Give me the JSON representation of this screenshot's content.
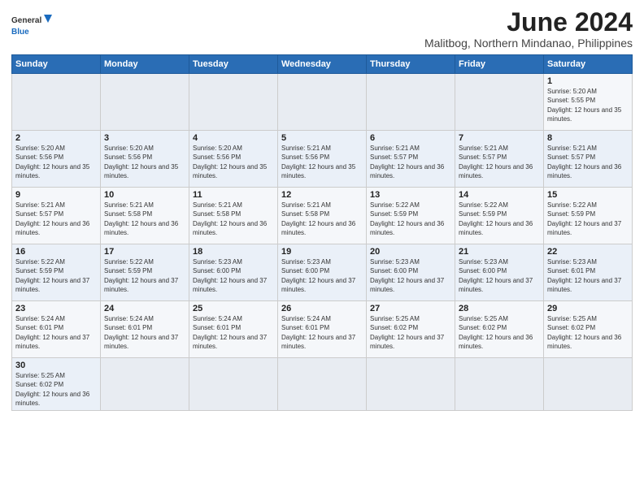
{
  "header": {
    "logo_general": "General",
    "logo_blue": "Blue",
    "title": "June 2024",
    "subtitle": "Malitbog, Northern Mindanao, Philippines"
  },
  "days_of_week": [
    "Sunday",
    "Monday",
    "Tuesday",
    "Wednesday",
    "Thursday",
    "Friday",
    "Saturday"
  ],
  "weeks": [
    [
      {
        "day": "",
        "info": ""
      },
      {
        "day": "",
        "info": ""
      },
      {
        "day": "",
        "info": ""
      },
      {
        "day": "",
        "info": ""
      },
      {
        "day": "",
        "info": ""
      },
      {
        "day": "",
        "info": ""
      },
      {
        "day": "1",
        "info": "Sunrise: 5:20 AM\nSunset: 5:55 PM\nDaylight: 12 hours and 35 minutes."
      }
    ],
    [
      {
        "day": "2",
        "info": "Sunrise: 5:20 AM\nSunset: 5:56 PM\nDaylight: 12 hours and 35 minutes."
      },
      {
        "day": "3",
        "info": "Sunrise: 5:20 AM\nSunset: 5:56 PM\nDaylight: 12 hours and 35 minutes."
      },
      {
        "day": "4",
        "info": "Sunrise: 5:20 AM\nSunset: 5:56 PM\nDaylight: 12 hours and 35 minutes."
      },
      {
        "day": "5",
        "info": "Sunrise: 5:21 AM\nSunset: 5:56 PM\nDaylight: 12 hours and 35 minutes."
      },
      {
        "day": "6",
        "info": "Sunrise: 5:21 AM\nSunset: 5:57 PM\nDaylight: 12 hours and 36 minutes."
      },
      {
        "day": "7",
        "info": "Sunrise: 5:21 AM\nSunset: 5:57 PM\nDaylight: 12 hours and 36 minutes."
      },
      {
        "day": "8",
        "info": "Sunrise: 5:21 AM\nSunset: 5:57 PM\nDaylight: 12 hours and 36 minutes."
      }
    ],
    [
      {
        "day": "9",
        "info": "Sunrise: 5:21 AM\nSunset: 5:57 PM\nDaylight: 12 hours and 36 minutes."
      },
      {
        "day": "10",
        "info": "Sunrise: 5:21 AM\nSunset: 5:58 PM\nDaylight: 12 hours and 36 minutes."
      },
      {
        "day": "11",
        "info": "Sunrise: 5:21 AM\nSunset: 5:58 PM\nDaylight: 12 hours and 36 minutes."
      },
      {
        "day": "12",
        "info": "Sunrise: 5:21 AM\nSunset: 5:58 PM\nDaylight: 12 hours and 36 minutes."
      },
      {
        "day": "13",
        "info": "Sunrise: 5:22 AM\nSunset: 5:59 PM\nDaylight: 12 hours and 36 minutes."
      },
      {
        "day": "14",
        "info": "Sunrise: 5:22 AM\nSunset: 5:59 PM\nDaylight: 12 hours and 36 minutes."
      },
      {
        "day": "15",
        "info": "Sunrise: 5:22 AM\nSunset: 5:59 PM\nDaylight: 12 hours and 37 minutes."
      }
    ],
    [
      {
        "day": "16",
        "info": "Sunrise: 5:22 AM\nSunset: 5:59 PM\nDaylight: 12 hours and 37 minutes."
      },
      {
        "day": "17",
        "info": "Sunrise: 5:22 AM\nSunset: 5:59 PM\nDaylight: 12 hours and 37 minutes."
      },
      {
        "day": "18",
        "info": "Sunrise: 5:23 AM\nSunset: 6:00 PM\nDaylight: 12 hours and 37 minutes."
      },
      {
        "day": "19",
        "info": "Sunrise: 5:23 AM\nSunset: 6:00 PM\nDaylight: 12 hours and 37 minutes."
      },
      {
        "day": "20",
        "info": "Sunrise: 5:23 AM\nSunset: 6:00 PM\nDaylight: 12 hours and 37 minutes."
      },
      {
        "day": "21",
        "info": "Sunrise: 5:23 AM\nSunset: 6:00 PM\nDaylight: 12 hours and 37 minutes."
      },
      {
        "day": "22",
        "info": "Sunrise: 5:23 AM\nSunset: 6:01 PM\nDaylight: 12 hours and 37 minutes."
      }
    ],
    [
      {
        "day": "23",
        "info": "Sunrise: 5:24 AM\nSunset: 6:01 PM\nDaylight: 12 hours and 37 minutes."
      },
      {
        "day": "24",
        "info": "Sunrise: 5:24 AM\nSunset: 6:01 PM\nDaylight: 12 hours and 37 minutes."
      },
      {
        "day": "25",
        "info": "Sunrise: 5:24 AM\nSunset: 6:01 PM\nDaylight: 12 hours and 37 minutes."
      },
      {
        "day": "26",
        "info": "Sunrise: 5:24 AM\nSunset: 6:01 PM\nDaylight: 12 hours and 37 minutes."
      },
      {
        "day": "27",
        "info": "Sunrise: 5:25 AM\nSunset: 6:02 PM\nDaylight: 12 hours and 37 minutes."
      },
      {
        "day": "28",
        "info": "Sunrise: 5:25 AM\nSunset: 6:02 PM\nDaylight: 12 hours and 36 minutes."
      },
      {
        "day": "29",
        "info": "Sunrise: 5:25 AM\nSunset: 6:02 PM\nDaylight: 12 hours and 36 minutes."
      }
    ],
    [
      {
        "day": "30",
        "info": "Sunrise: 5:25 AM\nSunset: 6:02 PM\nDaylight: 12 hours and 36 minutes."
      },
      {
        "day": "",
        "info": ""
      },
      {
        "day": "",
        "info": ""
      },
      {
        "day": "",
        "info": ""
      },
      {
        "day": "",
        "info": ""
      },
      {
        "day": "",
        "info": ""
      },
      {
        "day": "",
        "info": ""
      }
    ]
  ]
}
